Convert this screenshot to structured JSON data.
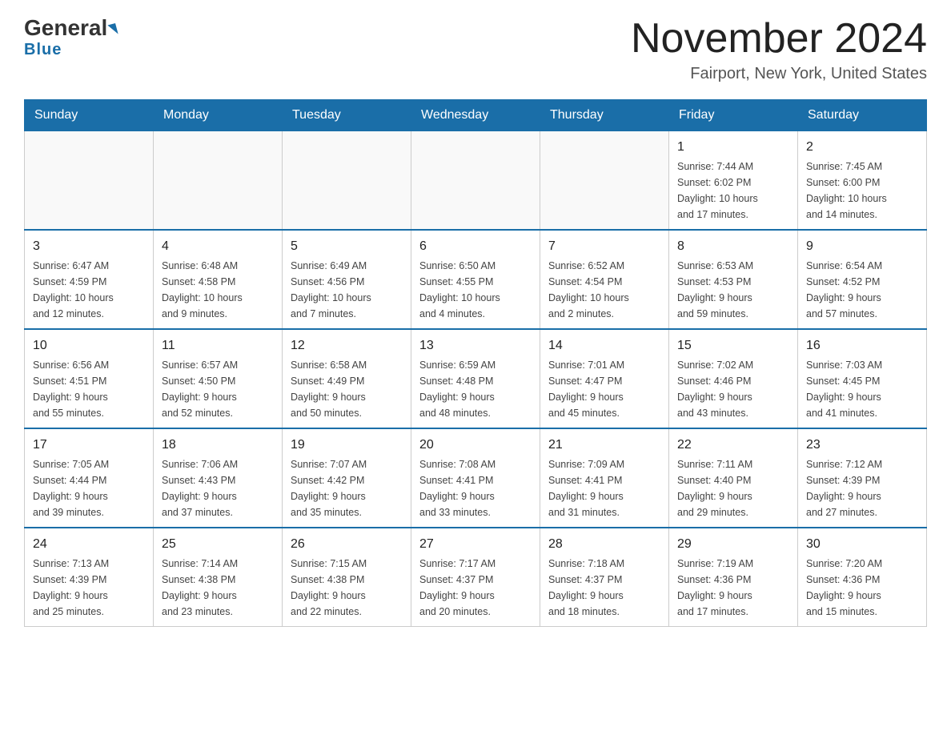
{
  "header": {
    "logo_general": "General",
    "logo_blue": "Blue",
    "month_title": "November 2024",
    "location": "Fairport, New York, United States"
  },
  "weekdays": [
    "Sunday",
    "Monday",
    "Tuesday",
    "Wednesday",
    "Thursday",
    "Friday",
    "Saturday"
  ],
  "weeks": [
    [
      {
        "day": "",
        "info": ""
      },
      {
        "day": "",
        "info": ""
      },
      {
        "day": "",
        "info": ""
      },
      {
        "day": "",
        "info": ""
      },
      {
        "day": "",
        "info": ""
      },
      {
        "day": "1",
        "info": "Sunrise: 7:44 AM\nSunset: 6:02 PM\nDaylight: 10 hours\nand 17 minutes."
      },
      {
        "day": "2",
        "info": "Sunrise: 7:45 AM\nSunset: 6:00 PM\nDaylight: 10 hours\nand 14 minutes."
      }
    ],
    [
      {
        "day": "3",
        "info": "Sunrise: 6:47 AM\nSunset: 4:59 PM\nDaylight: 10 hours\nand 12 minutes."
      },
      {
        "day": "4",
        "info": "Sunrise: 6:48 AM\nSunset: 4:58 PM\nDaylight: 10 hours\nand 9 minutes."
      },
      {
        "day": "5",
        "info": "Sunrise: 6:49 AM\nSunset: 4:56 PM\nDaylight: 10 hours\nand 7 minutes."
      },
      {
        "day": "6",
        "info": "Sunrise: 6:50 AM\nSunset: 4:55 PM\nDaylight: 10 hours\nand 4 minutes."
      },
      {
        "day": "7",
        "info": "Sunrise: 6:52 AM\nSunset: 4:54 PM\nDaylight: 10 hours\nand 2 minutes."
      },
      {
        "day": "8",
        "info": "Sunrise: 6:53 AM\nSunset: 4:53 PM\nDaylight: 9 hours\nand 59 minutes."
      },
      {
        "day": "9",
        "info": "Sunrise: 6:54 AM\nSunset: 4:52 PM\nDaylight: 9 hours\nand 57 minutes."
      }
    ],
    [
      {
        "day": "10",
        "info": "Sunrise: 6:56 AM\nSunset: 4:51 PM\nDaylight: 9 hours\nand 55 minutes."
      },
      {
        "day": "11",
        "info": "Sunrise: 6:57 AM\nSunset: 4:50 PM\nDaylight: 9 hours\nand 52 minutes."
      },
      {
        "day": "12",
        "info": "Sunrise: 6:58 AM\nSunset: 4:49 PM\nDaylight: 9 hours\nand 50 minutes."
      },
      {
        "day": "13",
        "info": "Sunrise: 6:59 AM\nSunset: 4:48 PM\nDaylight: 9 hours\nand 48 minutes."
      },
      {
        "day": "14",
        "info": "Sunrise: 7:01 AM\nSunset: 4:47 PM\nDaylight: 9 hours\nand 45 minutes."
      },
      {
        "day": "15",
        "info": "Sunrise: 7:02 AM\nSunset: 4:46 PM\nDaylight: 9 hours\nand 43 minutes."
      },
      {
        "day": "16",
        "info": "Sunrise: 7:03 AM\nSunset: 4:45 PM\nDaylight: 9 hours\nand 41 minutes."
      }
    ],
    [
      {
        "day": "17",
        "info": "Sunrise: 7:05 AM\nSunset: 4:44 PM\nDaylight: 9 hours\nand 39 minutes."
      },
      {
        "day": "18",
        "info": "Sunrise: 7:06 AM\nSunset: 4:43 PM\nDaylight: 9 hours\nand 37 minutes."
      },
      {
        "day": "19",
        "info": "Sunrise: 7:07 AM\nSunset: 4:42 PM\nDaylight: 9 hours\nand 35 minutes."
      },
      {
        "day": "20",
        "info": "Sunrise: 7:08 AM\nSunset: 4:41 PM\nDaylight: 9 hours\nand 33 minutes."
      },
      {
        "day": "21",
        "info": "Sunrise: 7:09 AM\nSunset: 4:41 PM\nDaylight: 9 hours\nand 31 minutes."
      },
      {
        "day": "22",
        "info": "Sunrise: 7:11 AM\nSunset: 4:40 PM\nDaylight: 9 hours\nand 29 minutes."
      },
      {
        "day": "23",
        "info": "Sunrise: 7:12 AM\nSunset: 4:39 PM\nDaylight: 9 hours\nand 27 minutes."
      }
    ],
    [
      {
        "day": "24",
        "info": "Sunrise: 7:13 AM\nSunset: 4:39 PM\nDaylight: 9 hours\nand 25 minutes."
      },
      {
        "day": "25",
        "info": "Sunrise: 7:14 AM\nSunset: 4:38 PM\nDaylight: 9 hours\nand 23 minutes."
      },
      {
        "day": "26",
        "info": "Sunrise: 7:15 AM\nSunset: 4:38 PM\nDaylight: 9 hours\nand 22 minutes."
      },
      {
        "day": "27",
        "info": "Sunrise: 7:17 AM\nSunset: 4:37 PM\nDaylight: 9 hours\nand 20 minutes."
      },
      {
        "day": "28",
        "info": "Sunrise: 7:18 AM\nSunset: 4:37 PM\nDaylight: 9 hours\nand 18 minutes."
      },
      {
        "day": "29",
        "info": "Sunrise: 7:19 AM\nSunset: 4:36 PM\nDaylight: 9 hours\nand 17 minutes."
      },
      {
        "day": "30",
        "info": "Sunrise: 7:20 AM\nSunset: 4:36 PM\nDaylight: 9 hours\nand 15 minutes."
      }
    ]
  ]
}
